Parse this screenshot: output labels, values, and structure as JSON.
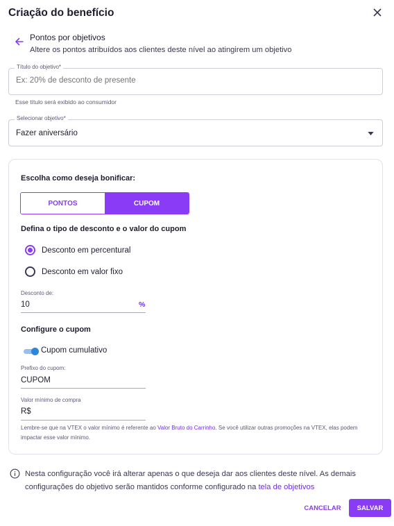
{
  "dialog": {
    "title": "Criação do benefício"
  },
  "section": {
    "title": "Pontos por objetivos",
    "subtitle": "Altere os pontos atribuídos aos clientes deste nível ao atingirem um objetivo"
  },
  "objective_title_field": {
    "label": "Título do objetivo*",
    "placeholder": "Ex: 20% de desconto de presente",
    "value": "",
    "helper": "Esse título será exibido ao consumidor"
  },
  "objective_select": {
    "label": "Selecionar objetivo*",
    "selected": "Fazer aniversário"
  },
  "bonus": {
    "heading": "Escolha como deseja bonificar:",
    "options": [
      "PONTOS",
      "CUPOM"
    ],
    "selected": "CUPOM"
  },
  "discount_type": {
    "heading": "Defina o tipo de desconto e o valor do cupom",
    "options": [
      "Desconto em percentural",
      "Desconto em valor fixo"
    ],
    "selected": "Desconto em percentural"
  },
  "discount_value": {
    "label": "Desconto de:",
    "value": "10",
    "suffix": "%"
  },
  "coupon": {
    "heading": "Configure o cupom",
    "cumulative_label": "Cupom cumulativo",
    "cumulative_on": true,
    "prefix_label": "Prefixo do cupom:",
    "prefix_value": "CUPOM",
    "min_purchase_label": "Valor mínimo de compra",
    "min_purchase_value": "R$",
    "note_before": "Lembre-se que na VTEX o valor mínimo é referente ao ",
    "note_link": "Valor Bruto do Carrinho",
    "note_after": ". Se você utilizar outras promoções na VTEX, elas podem impactar esse valor mínimo."
  },
  "info": {
    "text": "Nesta configuração você irá alterar apenas o que deseja dar aos clientes deste nível. As demais configurações do objetivo serão mantidos conforme configurado na ",
    "link": "tela de objetivos"
  },
  "actions": {
    "cancel": "CANCELAR",
    "save": "SALVAR"
  },
  "colors": {
    "accent": "#8a3bf5",
    "link": "#6d2ee6",
    "switch": "#2a87e0"
  }
}
